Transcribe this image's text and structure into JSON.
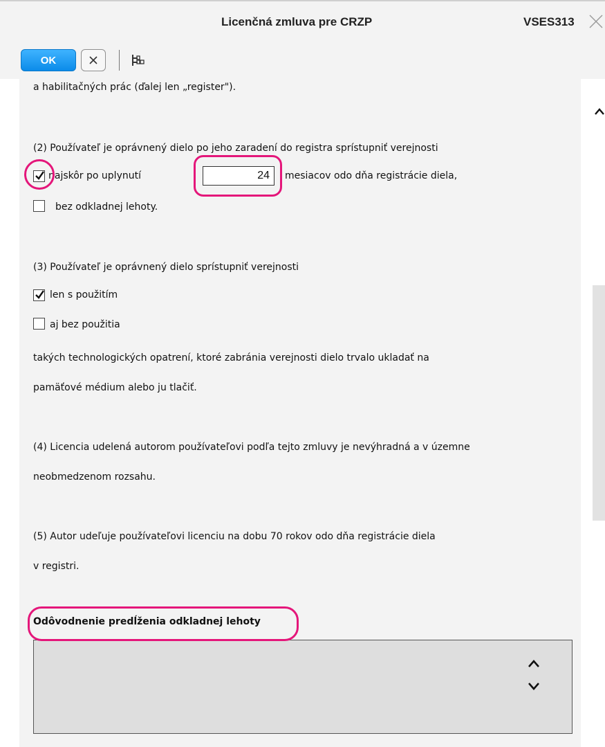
{
  "window": {
    "title": "Licenčná zmluva pre CRZP",
    "code": "VSES313"
  },
  "toolbar": {
    "ok_label": "OK"
  },
  "icons": [
    "close-icon",
    "cancel-x-icon",
    "tree-icon",
    "scroll-up-icon",
    "chevron-up-icon",
    "chevron-down-icon",
    "checkmark-icon"
  ],
  "content": {
    "cut_line": "a habilitačných prác (ďalej len „register\").",
    "sec2_intro": "(2) Používateľ je oprávnený dielo po jeho zaradení do registra sprístupniť verejnosti",
    "opt_delay_label": "najskôr po uplynutí",
    "opt_delay_months": "24",
    "opt_delay_suffix": "mesiacov odo dňa registrácie diela,",
    "opt_delay_checked": true,
    "opt_nodelay_label": "bez odkladnej lehoty.",
    "opt_nodelay_checked": false,
    "sec3_intro": "(3) Používateľ je oprávnený dielo sprístupniť verejnosti",
    "opt_with_label": "len s použitím",
    "opt_with_checked": true,
    "opt_without_label": "aj bez použitia",
    "opt_without_checked": false,
    "sec3_line1": "takých technologických opatrení, ktoré zabránia verejnosti dielo trvalo ukladať na",
    "sec3_line2": "pamäťové médium alebo ju tlačiť.",
    "sec4_line1": "(4) Licencia udelená autorom používateľovi podľa tejto zmluvy je nevýhradná a v územne",
    "sec4_line2": "neobmedzenom rozsahu.",
    "sec5_line1": "(5) Autor udeľuje používateľovi licenciu na dobu 70 rokov odo dňa registrácie diela",
    "sec5_line2": "v registri.",
    "justification_heading": "Odôvodnenie predĺženia odkladnej lehoty",
    "justification_value": ""
  },
  "colors": {
    "highlight": "#e4167a",
    "ok_button": "#0b8be9",
    "panel_bg": "#f3f3f3",
    "textarea_bg": "#dedede"
  }
}
